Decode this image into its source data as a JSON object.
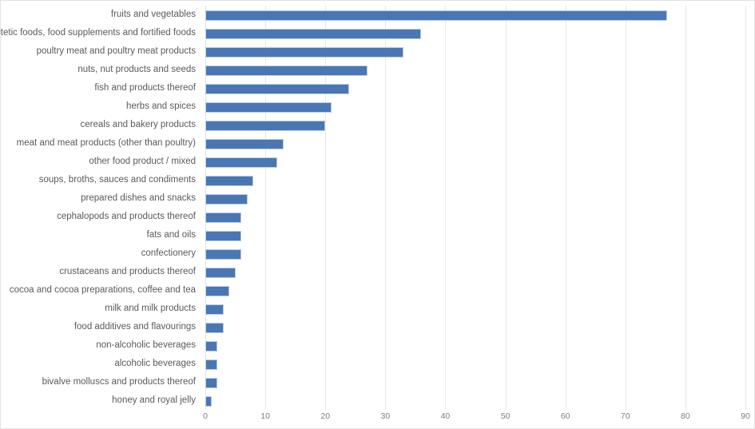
{
  "chart_data": {
    "type": "bar",
    "orientation": "horizontal",
    "title": "",
    "subtitle": "",
    "xlabel": "",
    "ylabel": "",
    "xlim": [
      0,
      90
    ],
    "x_ticks": [
      0,
      10,
      20,
      30,
      40,
      50,
      60,
      70,
      80,
      90
    ],
    "grid": true,
    "legend": false,
    "legend_position": "none",
    "series_color": "#4a77b4",
    "categories": [
      "fruits and vegetables",
      "dietetic foods, food supplements and fortified foods",
      "poultry meat and poultry meat products",
      "nuts, nut products and seeds",
      "fish and products thereof",
      "herbs and spices",
      "cereals and bakery products",
      "meat and meat products (other than poultry)",
      "other food product / mixed",
      "soups, broths, sauces and condiments",
      "prepared dishes and snacks",
      "cephalopods and products thereof",
      "fats and oils",
      "confectionery",
      "crustaceans and products thereof",
      "cocoa and cocoa preparations, coffee and tea",
      "milk and milk products",
      "food additives and flavourings",
      "non-alcoholic beverages",
      "alcoholic beverages",
      "bivalve molluscs and products thereof",
      "honey and royal jelly"
    ],
    "values": [
      77,
      36,
      33,
      27,
      24,
      21,
      20,
      13,
      12,
      8,
      7,
      6,
      6,
      6,
      5,
      4,
      3,
      3,
      2,
      2,
      2,
      1
    ]
  },
  "colors": {
    "bar": "#4a77b4",
    "bar_outline": "#b8cce4",
    "gridline": "#e8e8e8",
    "label_text": "#5a5a5a",
    "tick_text": "#7f7f7f",
    "chart_border": "#e2e2e2",
    "background": "#ffffff"
  }
}
